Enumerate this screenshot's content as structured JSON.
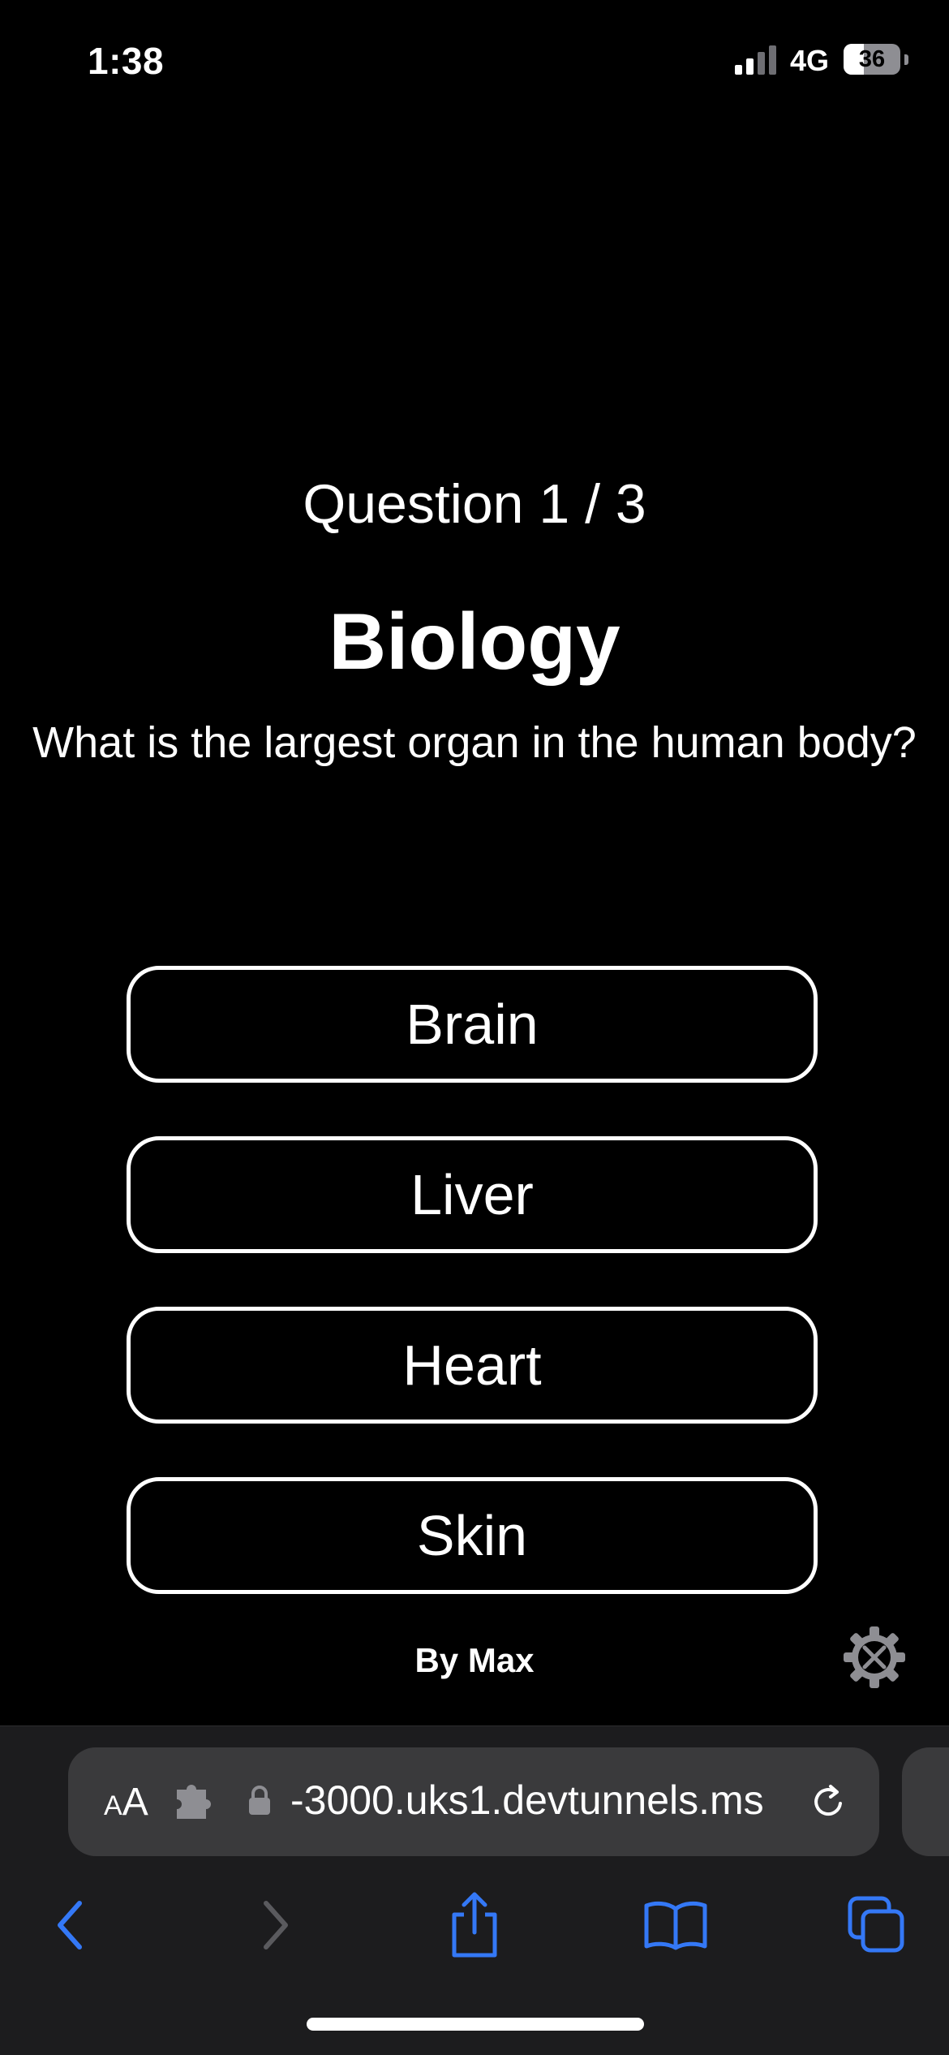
{
  "status_bar": {
    "time": "1:38",
    "network": "4G",
    "signal_bars_active": 2,
    "signal_bars_total": 4,
    "battery_percent": 36,
    "battery_label": "36"
  },
  "quiz": {
    "counter": "Question 1 / 3",
    "category": "Biology",
    "question": "What is the largest organ in the human body?",
    "answers": [
      {
        "label": "Brain"
      },
      {
        "label": "Liver"
      },
      {
        "label": "Heart"
      },
      {
        "label": "Skin"
      }
    ],
    "credit": "By Max",
    "settings_icon": "gear-tools-icon"
  },
  "browser": {
    "text_size_label_small": "A",
    "text_size_label_large": "A",
    "url": "-3000.uks1.devtunnels.ms",
    "icons": {
      "extension": "puzzle-piece-icon",
      "lock": "lock-icon",
      "reload": "reload-icon",
      "back": "chevron-left-icon",
      "forward": "chevron-right-icon",
      "share": "share-icon",
      "bookmarks": "open-book-icon",
      "tabs": "tabs-icon"
    },
    "colors": {
      "accent": "#3478f6",
      "disabled": "#5a5a5e"
    }
  }
}
